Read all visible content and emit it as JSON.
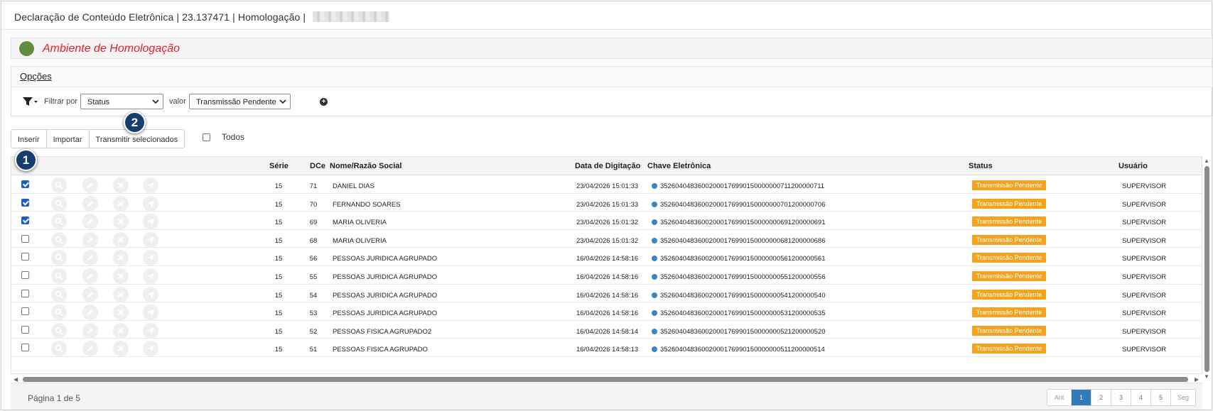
{
  "titlebar": {
    "app_title": "Declaração de Conteúdo Eletrônica",
    "version": "23.137471",
    "environment": "Homologação",
    "separator": "|"
  },
  "environment_banner": {
    "text": "Ambiente de Homologação",
    "indicator_color": "#5f8f3e",
    "text_color": "#e0212b"
  },
  "options": {
    "title": "Opções",
    "filter_by_label": "Filtrar por",
    "filter_field_value": "Status",
    "value_label": "valor",
    "filter_value": "Transmissão Pendente"
  },
  "toolbar": {
    "insert_label": "Inserir",
    "import_label": "Importar",
    "transmit_label": "Transmitir selecionados",
    "all_label": "Todos"
  },
  "callouts": {
    "one": "1",
    "two": "2"
  },
  "table": {
    "headers": {
      "serie": "Série",
      "dce": "DCe",
      "nome": "Nome/Razão Social",
      "data": "Data de Digitação",
      "chave": "Chave Eletrônica",
      "status": "Status",
      "usuario": "Usuário"
    },
    "rows": [
      {
        "checked": true,
        "serie": "15",
        "dce": "71",
        "nome": "DANIEL DIAS",
        "data": "23/04/2026 15:01:33",
        "chave": "35260404836002000176990150000000711200000711",
        "status": "Transmissão Pendente",
        "usuario": "SUPERVISOR"
      },
      {
        "checked": true,
        "serie": "15",
        "dce": "70",
        "nome": "FERNANDO SOARES",
        "data": "23/04/2026 15:01:33",
        "chave": "35260404836002000176990150000000701200000706",
        "status": "Transmissão Pendente",
        "usuario": "SUPERVISOR"
      },
      {
        "checked": true,
        "serie": "15",
        "dce": "69",
        "nome": "MARIA OLIVERIA",
        "data": "23/04/2026 15:01:32",
        "chave": "35260404836002000176990150000000691200000691",
        "status": "Transmissão Pendente",
        "usuario": "SUPERVISOR"
      },
      {
        "checked": false,
        "serie": "15",
        "dce": "68",
        "nome": "MARIA OLIVERIA",
        "data": "23/04/2026 15:01:32",
        "chave": "35260404836002000176990150000000681200000686",
        "status": "Transmissão Pendente",
        "usuario": "SUPERVISOR"
      },
      {
        "checked": false,
        "serie": "15",
        "dce": "56",
        "nome": "PESSOAS JURIDICA AGRUPADO",
        "data": "16/04/2026 14:58:16",
        "chave": "35260404836002000176990150000000561200000561",
        "status": "Transmissão Pendente",
        "usuario": "SUPERVISOR"
      },
      {
        "checked": false,
        "serie": "15",
        "dce": "55",
        "nome": "PESSOAS JURIDICA AGRUPADO",
        "data": "16/04/2026 14:58:16",
        "chave": "35260404836002000176990150000000551200000556",
        "status": "Transmissão Pendente",
        "usuario": "SUPERVISOR"
      },
      {
        "checked": false,
        "serie": "15",
        "dce": "54",
        "nome": "PESSOAS JURIDICA AGRUPADO",
        "data": "16/04/2026 14:58:16",
        "chave": "35260404836002000176990150000000541200000540",
        "status": "Transmissão Pendente",
        "usuario": "SUPERVISOR"
      },
      {
        "checked": false,
        "serie": "15",
        "dce": "53",
        "nome": "PESSOAS JURIDICA AGRUPADO",
        "data": "16/04/2026 14:58:16",
        "chave": "35260404836002000176990150000000531200000535",
        "status": "Transmissão Pendente",
        "usuario": "SUPERVISOR"
      },
      {
        "checked": false,
        "serie": "15",
        "dce": "52",
        "nome": "PESSOAS FISICA AGRUPADO2",
        "data": "16/04/2026 14:58:14",
        "chave": "35260404836002000176990150000000521200000520",
        "status": "Transmissão Pendente",
        "usuario": "SUPERVISOR"
      },
      {
        "checked": false,
        "serie": "15",
        "dce": "51",
        "nome": "PESSOAS FISICA AGRUPADO",
        "data": "16/04/2026 14:58:13",
        "chave": "35260404836002000176990150000000511200000514",
        "status": "Transmissão Pendente",
        "usuario": "SUPERVISOR"
      }
    ],
    "row_icons": [
      "search-icon",
      "edit-icon",
      "cancel-icon",
      "send-icon"
    ],
    "status_color": "#f5a31e"
  },
  "pagination": {
    "info": "Página 1 de 5",
    "prev_label": "Ant",
    "pages": [
      "1",
      "2",
      "3",
      "4",
      "5"
    ],
    "current_page": "1",
    "next_label": "Seg"
  }
}
